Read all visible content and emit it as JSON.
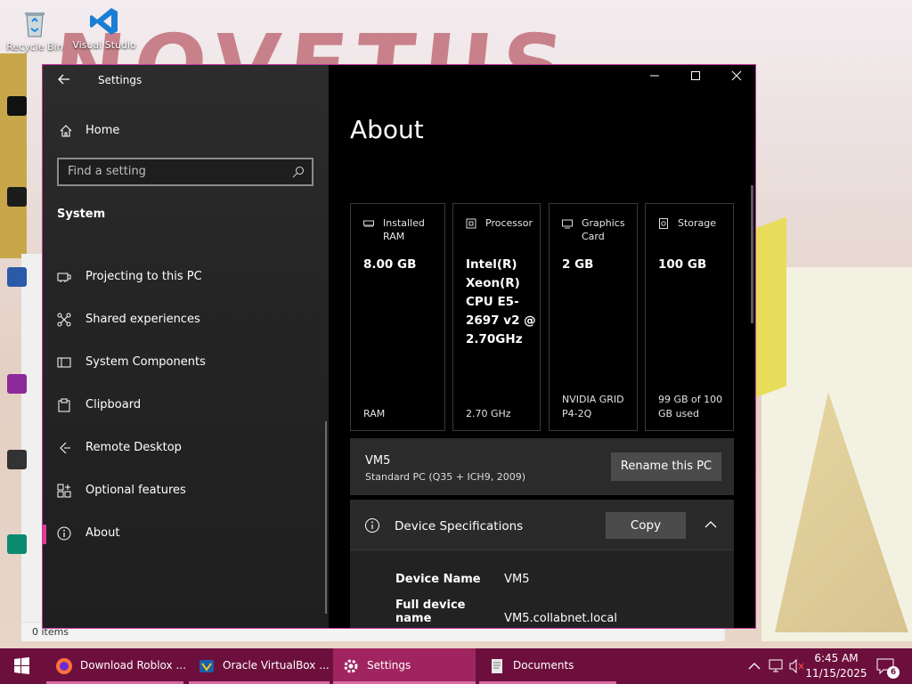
{
  "desktop": {
    "wallpaper_text": "NOVETUS",
    "icons": [
      {
        "label": "Recycle Bin",
        "icon": "recycle-bin-icon"
      },
      {
        "label": "Visual Studio",
        "icon": "visual-studio-icon"
      }
    ],
    "explorer_status": "0 items"
  },
  "window": {
    "app_title": "Settings",
    "nav": {
      "home_label": "Home",
      "search_placeholder": "Find a setting",
      "section": "System",
      "items": [
        {
          "label": "Projecting to this PC",
          "icon": "projector-icon"
        },
        {
          "label": "Shared experiences",
          "icon": "shared-experiences-icon"
        },
        {
          "label": "System Components",
          "icon": "system-components-icon"
        },
        {
          "label": "Clipboard",
          "icon": "clipboard-icon"
        },
        {
          "label": "Remote Desktop",
          "icon": "remote-desktop-icon"
        },
        {
          "label": "Optional features",
          "icon": "optional-features-icon"
        },
        {
          "label": "About",
          "icon": "info-icon",
          "active": true
        }
      ]
    },
    "page_title": "About",
    "spec_cards": [
      {
        "label": "Installed RAM",
        "value": "8.00 GB",
        "sub": "RAM",
        "icon": "ram-icon"
      },
      {
        "label": "Processor",
        "value": "Intel(R) Xeon(R) CPU E5-2697 v2 @ 2.70GHz",
        "sub": "2.70 GHz",
        "icon": "processor-icon"
      },
      {
        "label": "Graphics Card",
        "value": "2 GB",
        "sub": "NVIDIA GRID P4-2Q",
        "icon": "graphics-card-icon"
      },
      {
        "label": "Storage",
        "value": "100 GB",
        "sub": "99 GB of 100 GB used",
        "icon": "storage-icon"
      }
    ],
    "pc": {
      "name": "VM5",
      "model": "Standard PC (Q35 + ICH9, 2009)",
      "rename_label": "Rename this PC"
    },
    "device_specs": {
      "title": "Device Specifications",
      "copy_label": "Copy",
      "rows": [
        {
          "key": "Device Name",
          "value": "VM5"
        },
        {
          "key": "Full device name",
          "value": "VM5.collabnet.local"
        }
      ]
    }
  },
  "taskbar": {
    "items": [
      {
        "label": "Download Roblox ...",
        "icon": "firefox-icon"
      },
      {
        "label": "Oracle VirtualBox ...",
        "icon": "virtualbox-icon"
      },
      {
        "label": "Settings",
        "icon": "gear-icon",
        "active": true
      },
      {
        "label": "Documents",
        "icon": "documents-icon"
      }
    ],
    "time": "6:45 AM",
    "date": "11/15/2025",
    "notification_count": "6"
  }
}
